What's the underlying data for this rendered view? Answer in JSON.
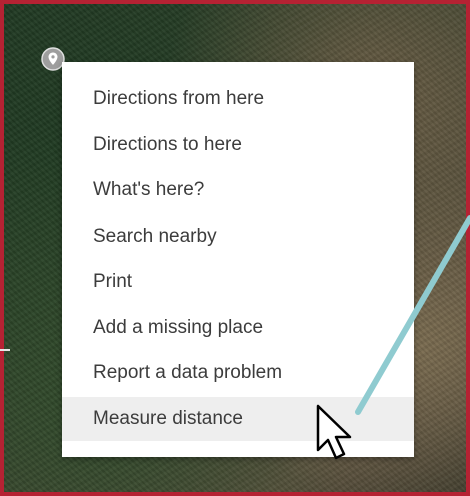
{
  "context_menu": {
    "items": [
      {
        "label": "Directions from here"
      },
      {
        "label": "Directions to here"
      },
      {
        "label": "What's here?"
      },
      {
        "label": "Search nearby"
      },
      {
        "label": "Print"
      },
      {
        "label": "Add a missing place"
      },
      {
        "label": "Report a data problem"
      },
      {
        "label": "Measure distance",
        "highlighted": true
      }
    ]
  },
  "icons": {
    "map_pin": "map-pin-icon",
    "cursor": "mouse-cursor-icon"
  },
  "colors": {
    "frame_border": "#b52233",
    "annotation_line": "#8fcbd0",
    "menu_background": "#ffffff",
    "menu_highlight": "#eeeeee",
    "menu_text": "#3c3c3c"
  }
}
